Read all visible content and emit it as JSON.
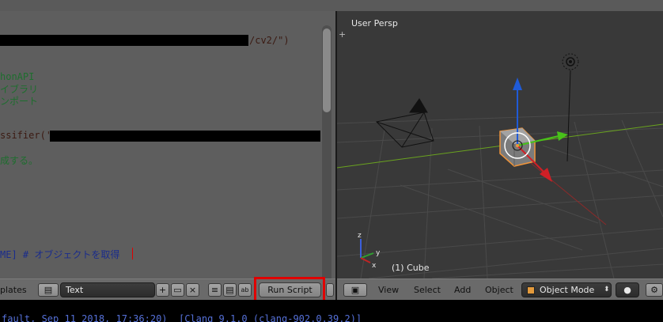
{
  "text_editor": {
    "lines": [
      {
        "text": "/cv2/\")",
        "color": "brown"
      },
      {
        "text": "honAPI",
        "color": "green"
      },
      {
        "text": "イブラリ",
        "color": "green"
      },
      {
        "text": "ンポート",
        "color": "green"
      },
      {
        "text": "ssifier('",
        "color": "brown"
      },
      {
        "text": "成する。",
        "color": "green"
      },
      {
        "text": "ME] # オブジェクトを取得",
        "color": "mixed"
      }
    ]
  },
  "text_header": {
    "templates_label": "plates",
    "datablock_name": "Text",
    "run_script_label": "Run Script"
  },
  "viewport": {
    "title": "User Persp",
    "active_object": "(1) Cube",
    "axis_labels": {
      "x": "x",
      "y": "y",
      "z": "z"
    }
  },
  "view3d_header": {
    "menu": [
      "View",
      "Select",
      "Add",
      "Object"
    ],
    "mode": "Object Mode"
  },
  "console": {
    "text": "fault, Sep 11 2018, 17:36:20)  [Clang 9.1.0 (clang-902.0.39.2)]"
  },
  "colors": {
    "highlight": "#e00000",
    "x_axis": "#6aa31f",
    "y_axis": "#8c2a2a",
    "manipulator_z": "#1f5bd8",
    "manipulator_x": "#d01f26",
    "manipulator_y": "#48c21a",
    "selection_outline": "#f1953a"
  }
}
